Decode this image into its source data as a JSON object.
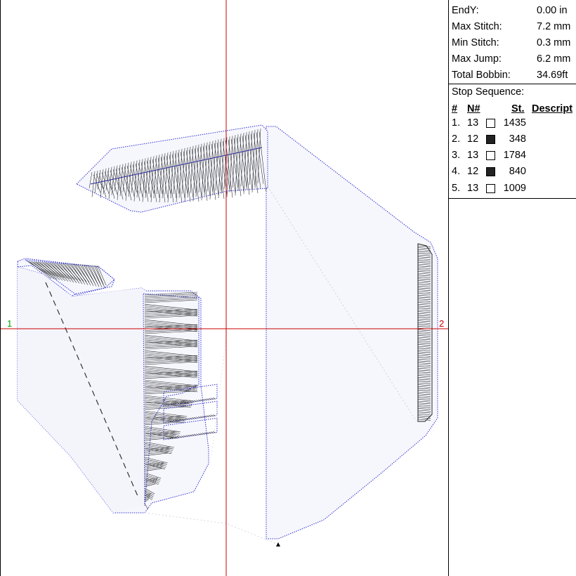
{
  "colors": {
    "axis_line": "#cc0000",
    "axis_label_left": "#00aa00",
    "axis_label_right": "#cc0000",
    "outline": "#3030d0",
    "stitch": "#222222",
    "fill_light": "#f6f7fd"
  },
  "canvas": {
    "left_axis_label": "1",
    "right_axis_label": "2"
  },
  "stats": [
    {
      "label": "EndY:",
      "value": "0.00 in"
    },
    {
      "label": "Max Stitch:",
      "value": "7.2 mm"
    },
    {
      "label": "Min Stitch:",
      "value": "0.3 mm"
    },
    {
      "label": "Max Jump:",
      "value": "6.2 mm"
    },
    {
      "label": "Total Bobbin:",
      "value": "34.69ft"
    }
  ],
  "stop_sequence": {
    "title": "Stop Sequence:",
    "headers": {
      "num": "#",
      "needle": "N#",
      "stitches": "St.",
      "description": "Descript"
    },
    "rows": [
      {
        "num": "1.",
        "needle": "13",
        "swatch": "#ffffff",
        "stitches": "1435"
      },
      {
        "num": "2.",
        "needle": "12",
        "swatch": "#222222",
        "stitches": "348"
      },
      {
        "num": "3.",
        "needle": "13",
        "swatch": "#ffffff",
        "stitches": "1784"
      },
      {
        "num": "4.",
        "needle": "12",
        "swatch": "#222222",
        "stitches": "840"
      },
      {
        "num": "5.",
        "needle": "13",
        "swatch": "#ffffff",
        "stitches": "1009"
      }
    ]
  }
}
